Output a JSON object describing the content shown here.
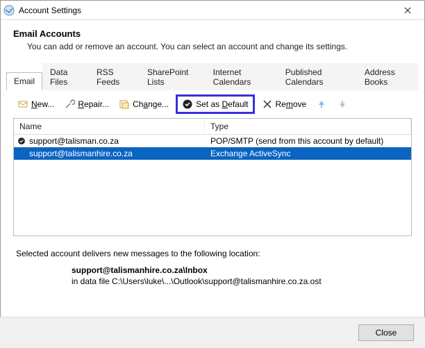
{
  "window": {
    "title": "Account Settings"
  },
  "heading": {
    "title": "Email Accounts",
    "subtitle": "You can add or remove an account. You can select an account and change its settings."
  },
  "tabs": [
    {
      "label": "Email"
    },
    {
      "label": "Data Files"
    },
    {
      "label": "RSS Feeds"
    },
    {
      "label": "SharePoint Lists"
    },
    {
      "label": "Internet Calendars"
    },
    {
      "label": "Published Calendars"
    },
    {
      "label": "Address Books"
    }
  ],
  "toolbar": {
    "new": "New...",
    "repair": "Repair...",
    "change": "Change...",
    "set_default": "Set as Default",
    "remove": "Remove"
  },
  "columns": {
    "name": "Name",
    "type": "Type"
  },
  "accounts": [
    {
      "name": "support@talisman.co.za",
      "type": "POP/SMTP (send from this account by default)",
      "default": true,
      "selected": false
    },
    {
      "name": "support@talismanhire.co.za",
      "type": "Exchange ActiveSync",
      "default": false,
      "selected": true
    }
  ],
  "footer": {
    "line1": "Selected account delivers new messages to the following location:",
    "line2": "support@talismanhire.co.za\\Inbox",
    "line3": "in data file C:\\Users\\luke\\...\\Outlook\\support@talismanhire.co.za.ost"
  },
  "buttons": {
    "close": "Close"
  }
}
